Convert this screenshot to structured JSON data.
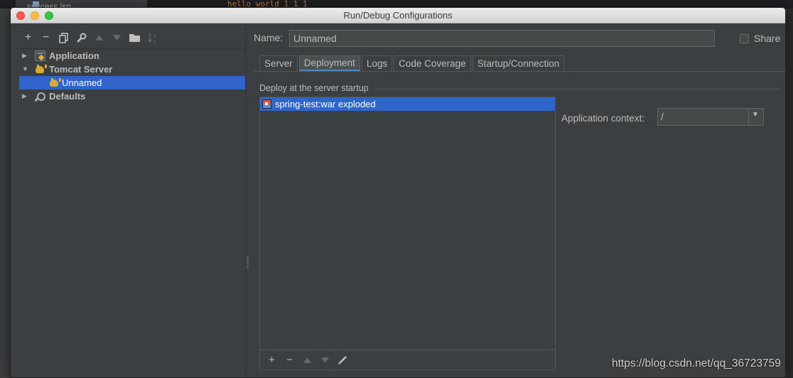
{
  "background": {
    "tab_label": "success.jsp",
    "code_fragment": "hello world 1 1 1"
  },
  "window": {
    "title": "Run/Debug Configurations"
  },
  "toolbar": {
    "add": "+",
    "remove": "−",
    "copy": "⧉",
    "edit_defaults": "🔧",
    "move_up": "▲",
    "move_down": "▼",
    "folder": "📁",
    "sort": "↓a"
  },
  "tree": {
    "items": [
      {
        "label": "Application",
        "arrow": "▶"
      },
      {
        "label": "Tomcat Server",
        "arrow": "▼"
      },
      {
        "label": "Unnamed"
      },
      {
        "label": "Defaults",
        "arrow": "▶"
      }
    ]
  },
  "config": {
    "name_label": "Name:",
    "name_value": "Unnamed",
    "share_label": "Share",
    "share_checked": false
  },
  "tabs": [
    {
      "label": "Server"
    },
    {
      "label": "Deployment",
      "active": true
    },
    {
      "label": "Logs"
    },
    {
      "label": "Code Coverage"
    },
    {
      "label": "Startup/Connection"
    }
  ],
  "deployment": {
    "section_title": "Deploy at the server startup",
    "artifacts": [
      "spring-test:war exploded"
    ],
    "list_toolbar": {
      "add": "+",
      "remove": "−",
      "up": "▲",
      "down": "▼",
      "edit": "✎"
    },
    "context_label": "Application context:",
    "context_value": "/",
    "context_arrow": "▼"
  },
  "watermark": "https://blog.csdn.net/qq_36723759",
  "colors": {
    "selection": "#2f65ca",
    "panel": "#3c3f41",
    "text": "#bbbbbb",
    "active_tab_underline": "#4a88c7"
  }
}
